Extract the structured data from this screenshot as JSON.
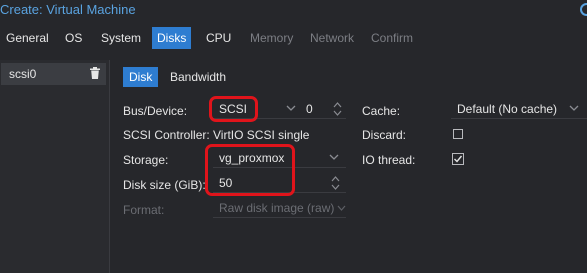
{
  "window": {
    "title": "Create: Virtual Machine"
  },
  "tabs": [
    {
      "label": "General",
      "state": "normal"
    },
    {
      "label": "OS",
      "state": "normal"
    },
    {
      "label": "System",
      "state": "normal"
    },
    {
      "label": "Disks",
      "state": "active"
    },
    {
      "label": "CPU",
      "state": "normal"
    },
    {
      "label": "Memory",
      "state": "disabled"
    },
    {
      "label": "Network",
      "state": "disabled"
    },
    {
      "label": "Confirm",
      "state": "disabled"
    }
  ],
  "disks": {
    "items": [
      {
        "label": "scsi0"
      }
    ]
  },
  "inner_tabs": [
    {
      "label": "Disk"
    },
    {
      "label": "Bandwidth"
    }
  ],
  "form": {
    "bus_device": {
      "label": "Bus/Device:",
      "bus": "SCSI",
      "device": "0"
    },
    "scsi_controller": {
      "label": "SCSI Controller:",
      "value": "VirtIO SCSI single"
    },
    "storage": {
      "label": "Storage:",
      "value": "vg_proxmox"
    },
    "disk_size": {
      "label": "Disk size (GiB):",
      "value": "50"
    },
    "format": {
      "label": "Format:",
      "value": "Raw disk image (raw)"
    },
    "cache": {
      "label": "Cache:",
      "value": "Default (No cache)"
    },
    "discard": {
      "label": "Discard:",
      "checked": false
    },
    "io_thread": {
      "label": "IO thread:",
      "checked": true
    }
  },
  "colors": {
    "accent": "#2e7dd1",
    "title": "#5aa3e0",
    "highlight": "#e0141b",
    "background": "#26272b"
  }
}
